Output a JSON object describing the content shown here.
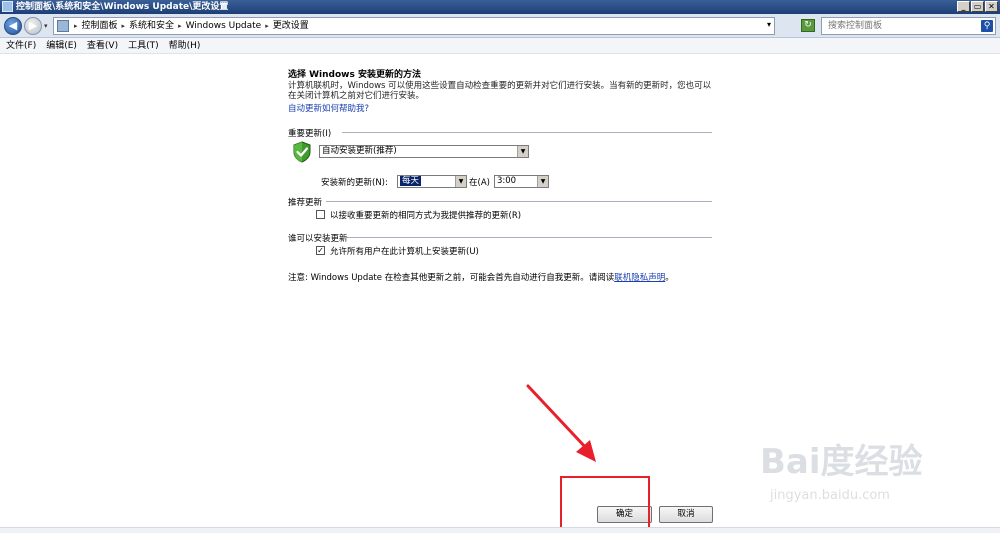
{
  "window": {
    "title": "控制面板\\系统和安全\\Windows Update\\更改设置"
  },
  "address": {
    "crumbs": [
      "控制面板",
      "系统和安全",
      "Windows Update",
      "更改设置"
    ],
    "search_placeholder": "搜索控制面板"
  },
  "menu": [
    "文件(F)",
    "编辑(E)",
    "查看(V)",
    "工具(T)",
    "帮助(H)"
  ],
  "page": {
    "title": "选择 Windows 安装更新的方法",
    "description": "计算机联机时，Windows 可以使用这些设置自动检查重要的更新并对它们进行安装。当有新的更新时，您也可以在关闭计算机之前对它们进行安装。",
    "help_link": "自动更新如何帮助我?"
  },
  "important": {
    "label": "重要更新(I)",
    "selected": "自动安装更新(推荐)",
    "install_label": "安装新的更新(N):",
    "day": "每天",
    "at_label": "在(A)",
    "time": "3:00"
  },
  "recommended": {
    "label": "推荐更新",
    "checkbox_label": "以接收重要更新的相同方式为我提供推荐的更新(R)",
    "checked": false
  },
  "who": {
    "label": "谁可以安装更新",
    "checkbox_label": "允许所有用户在此计算机上安装更新(U)",
    "checked": true
  },
  "note": {
    "text": "注意: Windows Update 在检查其他更新之前，可能会首先自动进行自我更新。请阅读",
    "link": "联机隐私声明",
    "end": "。"
  },
  "buttons": {
    "ok": "确定",
    "cancel": "取消"
  },
  "watermark": {
    "main": "Bai度经验",
    "sub": "jingyan.baidu.com"
  },
  "colors": {
    "titlebar": "#1c3f76",
    "link": "#1a3fb0",
    "annotation_red": "#e8202c",
    "selection": "#0a246a"
  }
}
